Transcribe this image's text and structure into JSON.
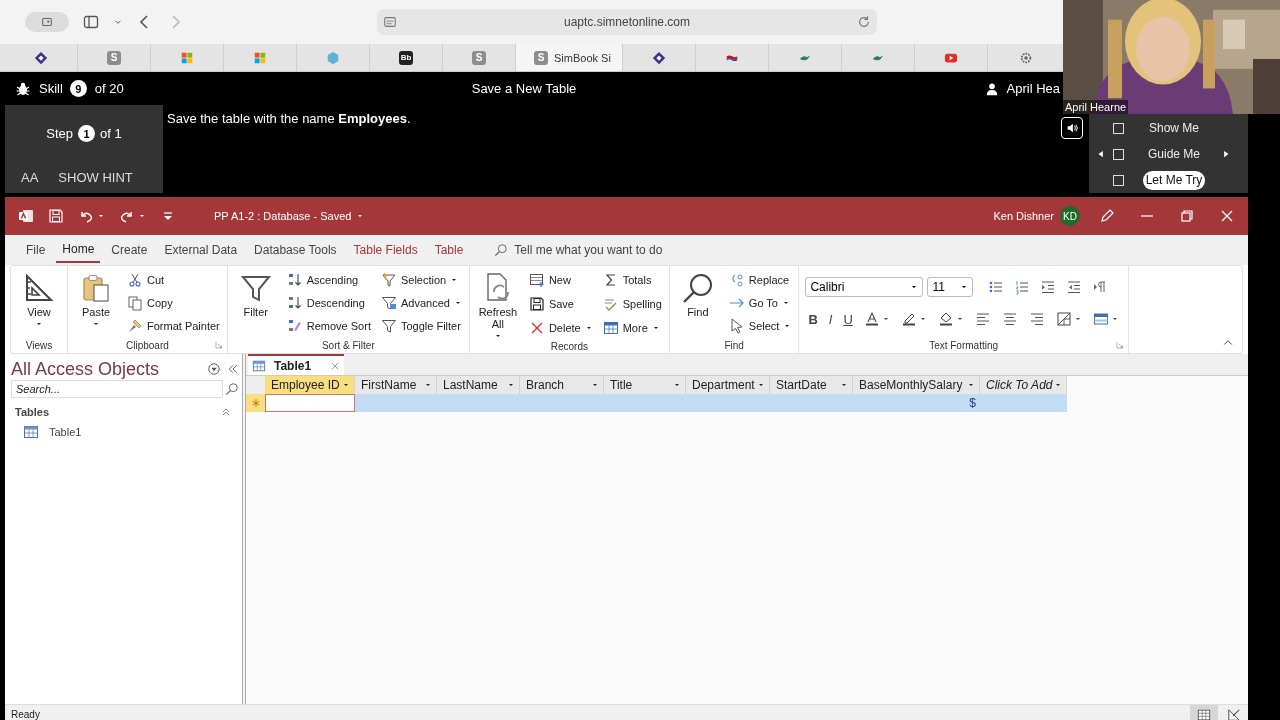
{
  "browser": {
    "url": "uaptc.simnetonline.com",
    "tabs": [
      {
        "kind": "diamond",
        "selected": false
      },
      {
        "kind": "letter",
        "text": "S",
        "selected": false
      },
      {
        "kind": "windows",
        "selected": false
      },
      {
        "kind": "windows",
        "selected": false
      },
      {
        "kind": "hexagon",
        "selected": false
      },
      {
        "kind": "letter",
        "text": "Bb",
        "selected": false
      },
      {
        "kind": "letter",
        "text": "S",
        "selected": false
      },
      {
        "kind": "letter",
        "text": "S",
        "label": "SimBook Si",
        "selected": true
      },
      {
        "kind": "diamond",
        "selected": false
      },
      {
        "kind": "flag",
        "selected": false
      },
      {
        "kind": "bird",
        "selected": false
      },
      {
        "kind": "bird",
        "selected": false
      },
      {
        "kind": "video",
        "selected": false
      },
      {
        "kind": "gear",
        "selected": false
      }
    ]
  },
  "skill_bar": {
    "label": "Skill",
    "number": "9",
    "total": "of 20",
    "title": "Save a New Table",
    "user": "April Hea"
  },
  "step": {
    "label": "Step",
    "number": "1",
    "total": "of 1"
  },
  "hint": {
    "font_toggle": "AA",
    "label": "SHOW HINT"
  },
  "instruction": "Save the table with the name **Employees**.",
  "modes": [
    {
      "label": "Show Me",
      "checked": false,
      "selected": false,
      "arrows": false
    },
    {
      "label": "Guide Me",
      "checked": false,
      "selected": false,
      "arrows": true
    },
    {
      "label": "Let Me Try",
      "checked": false,
      "selected": true,
      "arrows": false
    }
  ],
  "webcam": {
    "kind": "picture",
    "caption": "April Hearne"
  },
  "access": {
    "title": "PP A1-2 : Database - Saved",
    "user": "Ken Dishner",
    "initials": "KD",
    "tabs": [
      {
        "label": "File",
        "kind": "plain",
        "selected": false
      },
      {
        "label": "Home",
        "kind": "plain",
        "selected": true
      },
      {
        "label": "Create",
        "kind": "plain",
        "selected": false
      },
      {
        "label": "External Data",
        "kind": "plain",
        "selected": false
      },
      {
        "label": "Database Tools",
        "kind": "plain",
        "selected": false
      },
      {
        "label": "Table Fields",
        "kind": "contextual",
        "selected": false
      },
      {
        "label": "Table",
        "kind": "contextual",
        "selected": false
      }
    ],
    "tell_me": "Tell me what you want to do",
    "ribbon": [
      {
        "label": "Views",
        "kind": "buttons",
        "launcher": false,
        "large": {
          "kind": "view",
          "label": "View",
          "dropdown": true
        }
      },
      {
        "label": "Clipboard",
        "kind": "buttons",
        "launcher": true,
        "large": {
          "kind": "paste",
          "label": "Paste",
          "dropdown": true
        },
        "columns": [
          [
            {
              "kind": "cut",
              "label": "Cut",
              "dropdown": false
            },
            {
              "kind": "copy",
              "label": "Copy",
              "dropdown": false
            },
            {
              "kind": "painter",
              "label": "Format Painter",
              "dropdown": false
            }
          ]
        ]
      },
      {
        "label": "Sort & Filter",
        "kind": "buttons",
        "launcher": false,
        "large": {
          "kind": "filter",
          "label": "Filter",
          "dropdown": false
        },
        "columns": [
          [
            {
              "kind": "ascending",
              "label": "Ascending",
              "dropdown": false
            },
            {
              "kind": "descending",
              "label": "Descending",
              "dropdown": false
            },
            {
              "kind": "removesort",
              "label": "Remove Sort",
              "dropdown": false
            }
          ],
          [
            {
              "kind": "selection",
              "label": "Selection",
              "dropdown": true
            },
            {
              "kind": "advanced",
              "label": "Advanced",
              "dropdown": true
            },
            {
              "kind": "filter",
              "label": "Toggle Filter",
              "dropdown": false
            }
          ]
        ]
      },
      {
        "label": "Records",
        "kind": "buttons",
        "launcher": false,
        "large": {
          "kind": "refresh",
          "label": "Refresh All",
          "dropdown": true
        },
        "columns": [
          [
            {
              "kind": "new",
              "label": "New",
              "dropdown": false
            },
            {
              "kind": "save",
              "label": "Save",
              "dropdown": false
            },
            {
              "kind": "delete",
              "label": "Delete",
              "dropdown": true
            }
          ],
          [
            {
              "kind": "totals",
              "label": "Totals",
              "dropdown": false
            },
            {
              "kind": "spelling",
              "label": "Spelling",
              "dropdown": false
            },
            {
              "kind": "more",
              "label": "More",
              "dropdown": true
            }
          ]
        ]
      },
      {
        "label": "Find",
        "kind": "buttons",
        "launcher": false,
        "large": {
          "kind": "find",
          "label": "Find",
          "dropdown": false
        },
        "columns": [
          [
            {
              "kind": "replace",
              "label": "Replace",
              "dropdown": false
            },
            {
              "kind": "goto",
              "label": "Go To",
              "dropdown": true
            },
            {
              "kind": "select",
              "label": "Select",
              "dropdown": true
            }
          ]
        ]
      },
      {
        "label": "Text Formatting",
        "kind": "formatting",
        "launcher": true,
        "fields": [
          "Calibri",
          "11"
        ],
        "top_tools": [
          {
            "kind": "bullets",
            "dropdown": false
          },
          {
            "kind": "numbering",
            "dropdown": false
          },
          {
            "kind": "indent",
            "dropdown": false
          },
          {
            "kind": "outdent",
            "dropdown": false
          },
          {
            "kind": "direction",
            "dropdown": false
          }
        ],
        "bottom_tools": [
          {
            "kind": "bold",
            "text": "B",
            "dropdown": false
          },
          {
            "kind": "italic",
            "text": "I",
            "dropdown": false
          },
          {
            "kind": "underline",
            "text": "U",
            "dropdown": false
          },
          {
            "kind": "fontcolor",
            "dropdown": true
          },
          {
            "kind": "highlight",
            "dropdown": true
          },
          {
            "kind": "fill",
            "dropdown": true
          },
          {
            "kind": "alignleft",
            "dropdown": false
          },
          {
            "kind": "aligncenter",
            "dropdown": false
          },
          {
            "kind": "alignright",
            "dropdown": false
          },
          {
            "kind": "gridlines",
            "dropdown": true
          },
          {
            "kind": "altrow",
            "dropdown": true
          }
        ]
      }
    ],
    "nav": {
      "title": "All Access Objects",
      "search_placeholder": "Search...",
      "groups": [
        {
          "label": "Tables",
          "expanded": true,
          "items": [
            "Table1"
          ]
        }
      ]
    },
    "document_tab": "Table1",
    "columns": [
      {
        "label": "Employee ID",
        "kind": "field",
        "selected": true
      },
      {
        "label": "FirstName",
        "kind": "field",
        "selected": false
      },
      {
        "label": "LastName",
        "kind": "field",
        "selected": false
      },
      {
        "label": "Branch",
        "kind": "field",
        "selected": false
      },
      {
        "label": "Title",
        "kind": "field",
        "selected": false
      },
      {
        "label": "Department",
        "kind": "field",
        "selected": false
      },
      {
        "label": "StartDate",
        "kind": "field",
        "selected": false
      },
      {
        "label": "BaseMonthlySalary",
        "kind": "field",
        "selected": false
      },
      {
        "label": "Click To Add",
        "kind": "add",
        "selected": false
      }
    ],
    "new_row": {
      "selected": true,
      "cells": [
        "",
        "",
        "",
        "",
        "",
        "",
        "",
        "$",
        ""
      ]
    },
    "status": "Ready",
    "views": [
      {
        "kind": "datasheet",
        "selected": true
      },
      {
        "kind": "design",
        "selected": false
      }
    ]
  }
}
